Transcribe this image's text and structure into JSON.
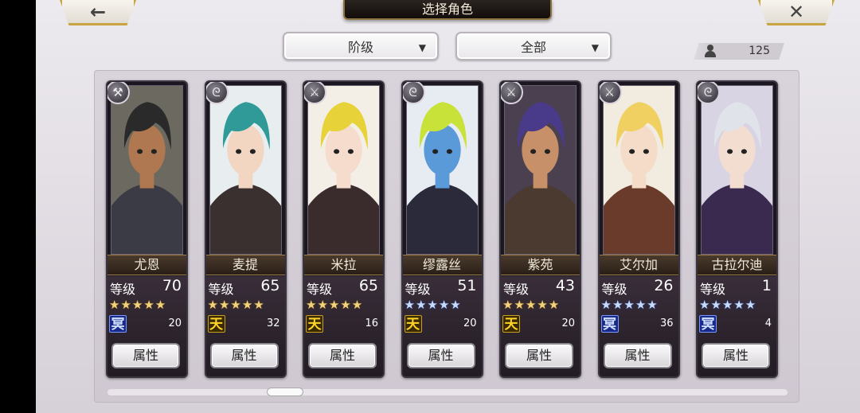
{
  "header": {
    "title": "选择角色",
    "back_icon": "←",
    "close_icon": "✕"
  },
  "filters": {
    "rank_label": "阶级",
    "all_label": "全部",
    "arrow": "▼"
  },
  "roster_count": "125",
  "attr_label": "属性",
  "level_label": "等级",
  "characters": [
    {
      "name": "尤恩",
      "level": "70",
      "stars": "★★★★★",
      "star_color": "gold",
      "emblem": "冥",
      "emblem_type": "ming",
      "count": "20",
      "class_icon": "hammer-icon",
      "class_glyph": "⚒",
      "hair": "#2a2a2a",
      "skin": "#b07850",
      "cloth": "#3b3b45",
      "bg": "#6c6a60"
    },
    {
      "name": "麦提",
      "level": "65",
      "stars": "★★★★★",
      "star_color": "gold",
      "emblem": "天",
      "emblem_type": "tian",
      "count": "32",
      "class_icon": "staff-icon",
      "class_glyph": "ᘓ",
      "hair": "#2f9a98",
      "skin": "#f2d6c2",
      "cloth": "#3a3030",
      "bg": "#e8eef0"
    },
    {
      "name": "米拉",
      "level": "65",
      "stars": "★★★★★",
      "star_color": "gold",
      "emblem": "天",
      "emblem_type": "tian",
      "count": "16",
      "class_icon": "sword-icon",
      "class_glyph": "⚔",
      "hair": "#e8d23a",
      "skin": "#f6dccc",
      "cloth": "#3a2c2c",
      "bg": "#f4efe6"
    },
    {
      "name": "缪露丝",
      "level": "51",
      "stars": "★★★★★",
      "star_color": "blue",
      "emblem": "天",
      "emblem_type": "tian",
      "count": "20",
      "class_icon": "staff-icon",
      "class_glyph": "ᘓ",
      "hair": "#c8e23a",
      "skin": "#5a9ad8",
      "cloth": "#2a2a3a",
      "bg": "#e6ecf2"
    },
    {
      "name": "紫苑",
      "level": "43",
      "stars": "★★★★★",
      "star_color": "gold",
      "emblem": "天",
      "emblem_type": "tian",
      "count": "20",
      "class_icon": "sword-icon",
      "class_glyph": "⚔",
      "hair": "#4a3a8a",
      "skin": "#c89068",
      "cloth": "#4a3a30",
      "bg": "#4a4050"
    },
    {
      "name": "艾尔加",
      "level": "26",
      "stars": "★★★★★",
      "star_color": "blue",
      "emblem": "冥",
      "emblem_type": "ming",
      "count": "36",
      "class_icon": "sword-icon",
      "class_glyph": "⚔",
      "hair": "#f0d060",
      "skin": "#f4dcc8",
      "cloth": "#6a3a2a",
      "bg": "#f2ece0"
    },
    {
      "name": "古拉尔迪",
      "level": "1",
      "stars": "★★★★★",
      "star_color": "blue",
      "emblem": "冥",
      "emblem_type": "ming",
      "count": "4",
      "class_icon": "staff-icon",
      "class_glyph": "ᘓ",
      "hair": "#e0e4ea",
      "skin": "#f2ddd0",
      "cloth": "#3a2a50",
      "bg": "#d8d4e4"
    }
  ]
}
